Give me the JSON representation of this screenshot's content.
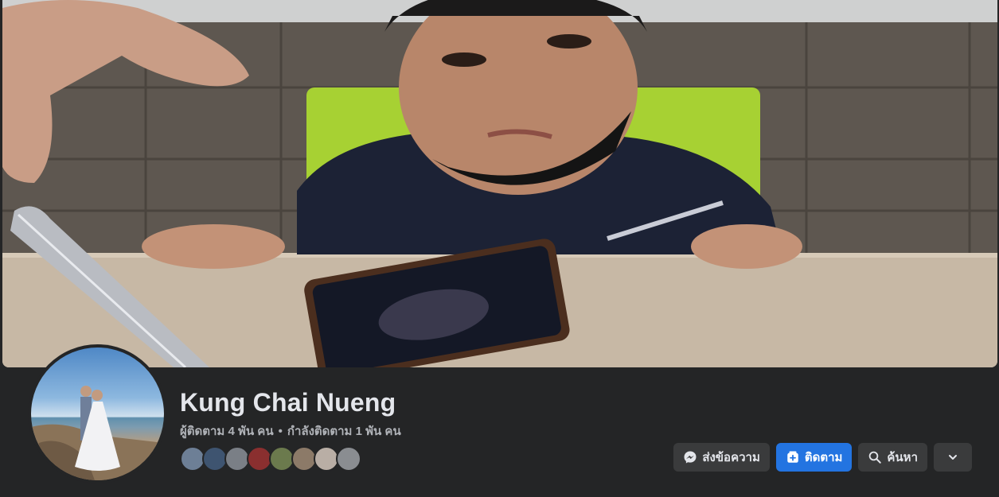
{
  "profile": {
    "name": "Kung Chai Nueng",
    "followers_text": "ผู้ติดตาม 4 พัน คน",
    "separator": "•",
    "following_text": "กำลังติดตาม 1 พัน คน"
  },
  "follower_avatars": [
    {
      "color": "#6d7f96"
    },
    {
      "color": "#3e5470"
    },
    {
      "color": "#7a7f86"
    },
    {
      "color": "#8a2f2f"
    },
    {
      "color": "#6b7a4d"
    },
    {
      "color": "#8c7a68"
    },
    {
      "color": "#b9aea5"
    },
    {
      "color": "#8a8d91"
    }
  ],
  "actions": {
    "message_label": "ส่งข้อความ",
    "follow_label": "ติดตาม",
    "search_label": "ค้นหา"
  },
  "icons": {
    "message": "messenger-icon",
    "follow": "follow-plus-icon",
    "search": "search-icon",
    "more": "chevron-down-icon"
  },
  "colors": {
    "background": "#242526",
    "primary_button": "#2374e1",
    "secondary_button": "#3a3b3c",
    "name_text": "#e4e6eb",
    "meta_text": "#b0b3b8"
  }
}
